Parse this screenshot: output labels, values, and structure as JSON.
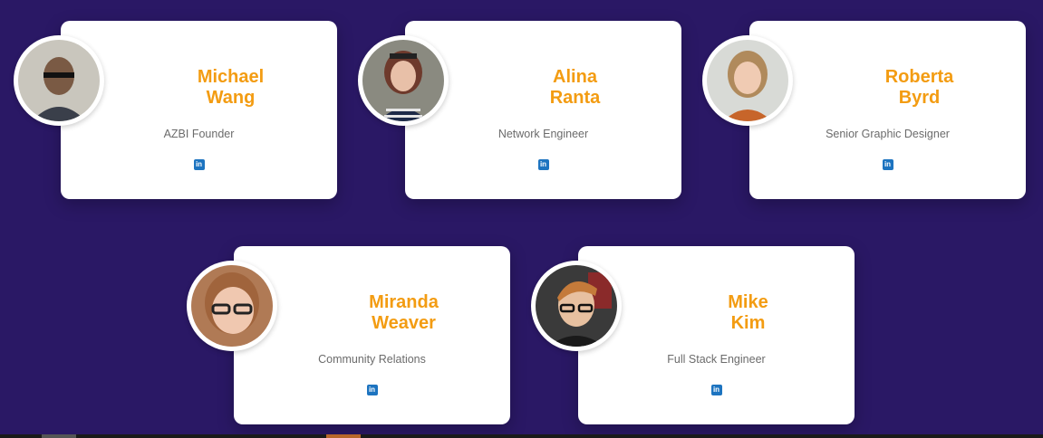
{
  "team": [
    {
      "first": "Michael",
      "last": "Wang",
      "role": "AZBI Founder",
      "social": "in"
    },
    {
      "first": "Alina",
      "last": "Ranta",
      "role": "Network Engineer",
      "social": "in"
    },
    {
      "first": "Roberta",
      "last": "Byrd",
      "role": "Senior Graphic Designer",
      "social": "in"
    },
    {
      "first": "Miranda",
      "last": "Weaver",
      "role": "Community Relations",
      "social": "in"
    },
    {
      "first": "Mike",
      "last": "Kim",
      "role": "Full Stack Engineer",
      "social": "in"
    }
  ],
  "colors": {
    "background": "#2a1865",
    "name": "#f39c12",
    "role": "#6b6b6b",
    "linkedin": "#1d74c0"
  },
  "icons": {
    "social": "linkedin-icon"
  }
}
